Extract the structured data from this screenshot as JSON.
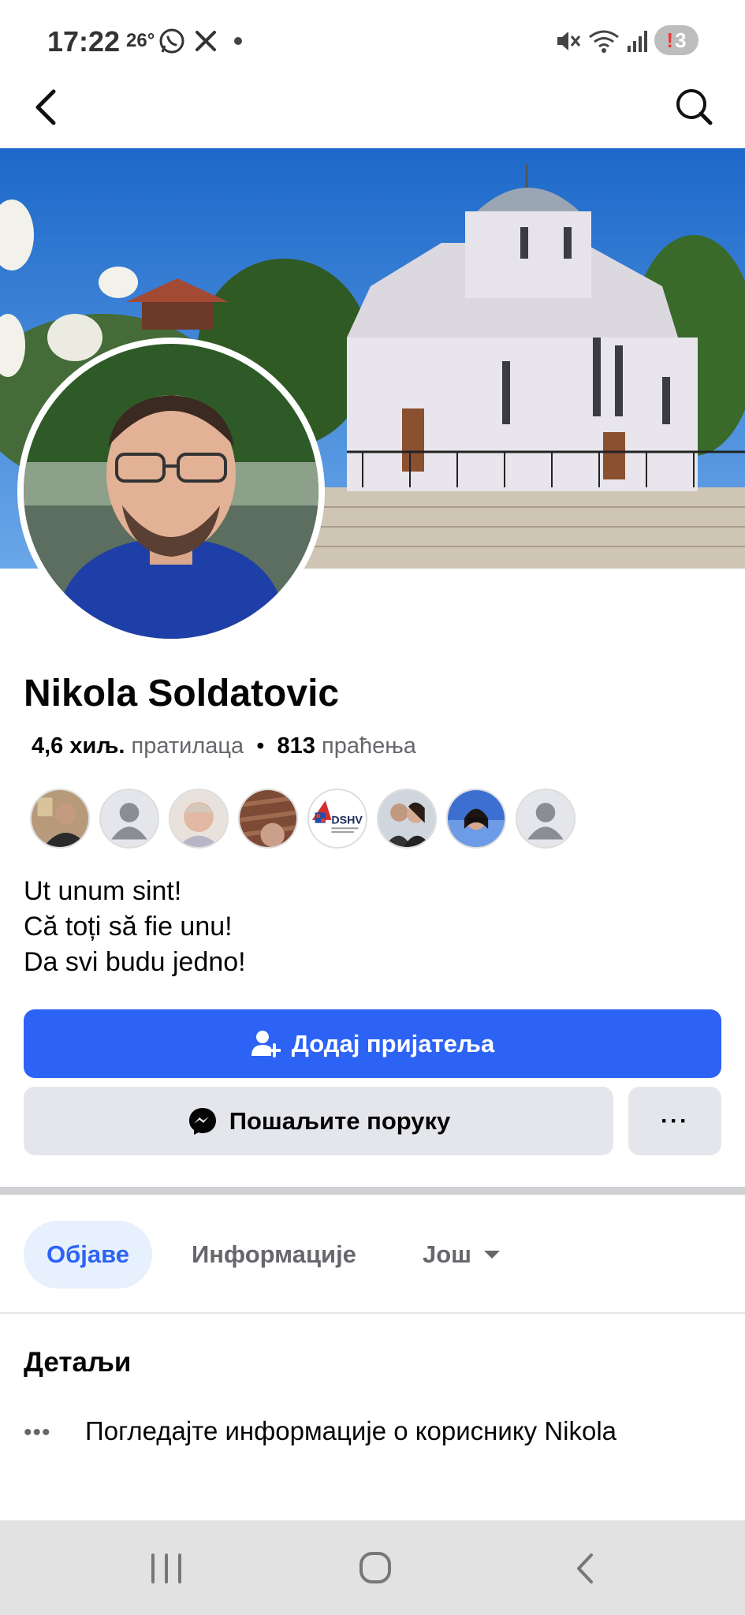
{
  "status_bar": {
    "time": "17:22",
    "temperature": "26°",
    "battery_count": "3",
    "icons": [
      "whatsapp-icon",
      "x-icon",
      "dot-icon",
      "mute-icon",
      "wifi-icon",
      "signal-icon"
    ]
  },
  "nav": {
    "back_icon": "back-icon",
    "search_icon": "search-icon"
  },
  "profile": {
    "name": "Nikola Soldatovic",
    "followers_count": "4,6 хиљ.",
    "followers_label": "пратилаца",
    "separator": "•",
    "following_count": "813",
    "following_label": "праћења"
  },
  "bio": {
    "lines": [
      "Ut unum sint!",
      "Că toți să fie unu!",
      "Da svi budu jedno!"
    ]
  },
  "friends_preview": {
    "badge_text": "DSHV"
  },
  "actions": {
    "add_friend": "Додај пријатеља",
    "message": "Пошаљите поруку",
    "more": "···"
  },
  "tabs": [
    {
      "label": "Објаве",
      "active": true
    },
    {
      "label": "Информације",
      "active": false
    },
    {
      "label": "Још",
      "active": false
    }
  ],
  "details": {
    "title": "Детаљи",
    "info_dots": "•••",
    "info_text": "Погледајте информације о кориснику Nikola"
  },
  "colors": {
    "primary": "#2d63f5",
    "button_gray": "#e4e6eb",
    "tab_active_bg": "#e7f0fd",
    "text_secondary": "#65676b"
  }
}
